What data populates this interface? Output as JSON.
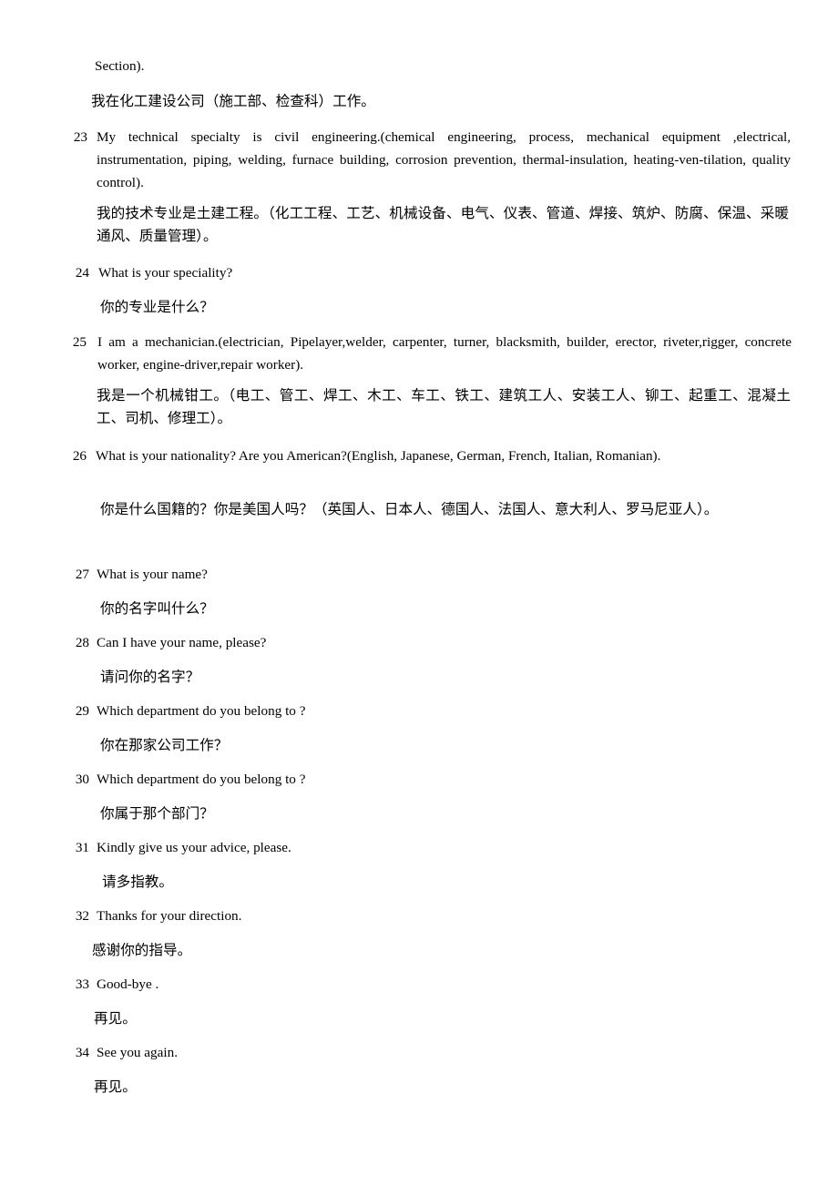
{
  "document": {
    "language_pair": "English-Chinese",
    "continued_line": "Section).",
    "continued_line_zh": "我在化工建设公司（施工部、检查科）工作。",
    "entries": [
      {
        "number": "23",
        "en": "My technical specialty is civil engineering.(chemical engineering, process, mechanical equipment ,electrical, instrumentation, piping, welding, furnace building, corrosion prevention, thermal-insulation, heating-ven-tilation, quality control).",
        "zh": "我的技术专业是土建工程。（化工工程、工艺、机械设备、电气、仪表、管道、焊接、筑炉、防腐、保温、采暖通风、质量管理）。"
      },
      {
        "number": "24",
        "en": "What is your speciality?",
        "zh": "你的专业是什么？"
      },
      {
        "number": "25",
        "en": "I am a mechanician.(electrician, Pipelayer,welder, carpenter, turner, blacksmith, builder, erector, riveter,rigger, concrete worker, engine-driver,repair worker).",
        "zh": "我是一个机械钳工。（电工、管工、焊工、木工、车工、铁工、建筑工人、安装工人、铆工、起重工、混凝土工、司机、修理工）。"
      },
      {
        "number": "26",
        "en": "What is your nationality? Are you American?(English, Japanese, German, French, Italian, Romanian).",
        "zh": "你是什么国籍的？你是美国人吗？（英国人、日本人、德国人、法国人、意大利人、罗马尼亚人）。"
      },
      {
        "number": "27",
        "en": "What is your name?",
        "zh": "你的名字叫什么？"
      },
      {
        "number": "28",
        "en": "Can I have your name, please?",
        "zh": "请问你的名字？"
      },
      {
        "number": "29",
        "en": "Which department do you belong to ?",
        "zh": "你在那家公司工作？"
      },
      {
        "number": "30",
        "en": "Which department do you belong to ?",
        "zh": "你属于那个部门？"
      },
      {
        "number": "31",
        "en": "Kindly give us your advice, please.",
        "zh": "请多指教。"
      },
      {
        "number": "32",
        "en": "Thanks for your direction.",
        "zh": "感谢你的指导。"
      },
      {
        "number": "33",
        "en": "Good-bye .",
        "zh": "再见。"
      },
      {
        "number": "34",
        "en": "See you again.",
        "zh": "再见。"
      }
    ]
  }
}
